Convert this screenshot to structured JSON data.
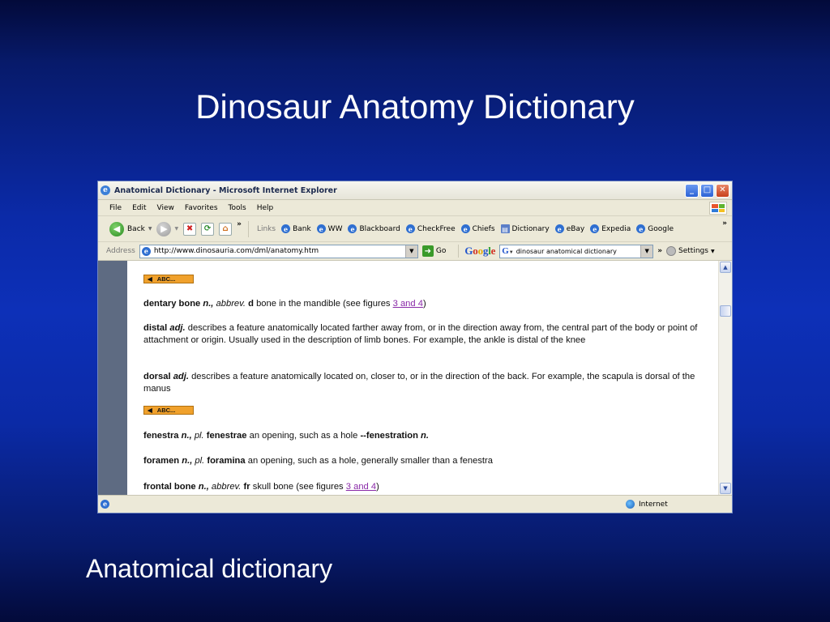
{
  "slide": {
    "title": "Dinosaur Anatomy Dictionary",
    "caption": "Anatomical dictionary"
  },
  "browser": {
    "window_title": "Anatomical Dictionary - Microsoft Internet Explorer",
    "menu": [
      "File",
      "Edit",
      "View",
      "Favorites",
      "Tools",
      "Help"
    ],
    "toolbar": {
      "back_label": "Back",
      "links_label": "Links",
      "links": [
        "Bank",
        "WW",
        "Blackboard",
        "CheckFree",
        "Chiefs",
        "Dictionary",
        "eBay",
        "Expedia",
        "Google"
      ]
    },
    "address": {
      "label": "Address",
      "url": "http://www.dinosauria.com/dml/anatomy.htm",
      "go_label": "Go"
    },
    "google_bar": {
      "logo": "Google",
      "query": "dinosaur anatomical dictionary",
      "settings_label": "Settings"
    },
    "status": {
      "zone": "Internet"
    }
  },
  "page": {
    "abc_label": "ABC...",
    "entries": {
      "dentary": {
        "term": "dentary bone",
        "pos": "n.,",
        "abbrev_lbl": "abbrev.",
        "abbrev": "d",
        "def": "bone in the mandible (see figures",
        "link": "3 and 4",
        "end": ")"
      },
      "distal": {
        "term": "distal",
        "pos": "adj.",
        "def": "describes a feature anatomically located farther away from, or in the direction away from, the central part of the body or point of attachment or origin. Usually used in the description of limb bones. For example, the ankle is distal of the knee"
      },
      "dorsal": {
        "term": "dorsal",
        "pos": "adj.",
        "def": "describes a feature anatomically located on, closer to, or in the direction of the back. For example, the scapula is dorsal of the manus"
      },
      "fenestra": {
        "term": "fenestra",
        "pos": "n.,",
        "pl_lbl": "pl.",
        "plural": "fenestrae",
        "def": "an opening, such as a hole",
        "derived": "--fenestration",
        "derived_pos": "n."
      },
      "foramen": {
        "term": "foramen",
        "pos": "n.,",
        "pl_lbl": "pl.",
        "plural": "foramina",
        "def": "an opening, such as a hole, generally smaller than a fenestra"
      },
      "frontal": {
        "term": "frontal bone",
        "pos": "n.,",
        "abbrev_lbl": "abbrev.",
        "abbrev": "fr",
        "def": "skull bone (see figures",
        "link": "3 and 4",
        "end": ")"
      }
    }
  }
}
